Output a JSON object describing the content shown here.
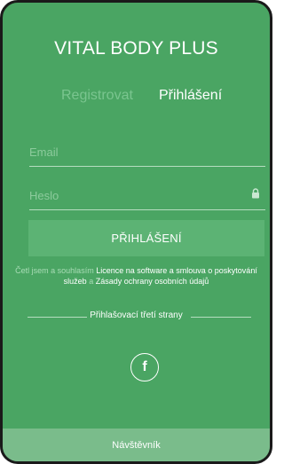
{
  "app": {
    "title": "VITAL BODY PLUS"
  },
  "tabs": [
    {
      "label": "Registrovat",
      "active": false
    },
    {
      "label": "Přihlášení",
      "active": true
    }
  ],
  "form": {
    "email_placeholder": "Email",
    "email_value": "",
    "password_placeholder": "Heslo",
    "password_value": "",
    "password_icon": "lock-icon",
    "submit_label": "PŘIHLÁŠENÍ"
  },
  "terms": {
    "prefix": "Četl jsem a souhlasím",
    "licence_link": "Licence na software a smlouva o poskytování služeb",
    "conjunction": "a",
    "privacy_link": "Zásady ochrany osobních údajů"
  },
  "third_party": {
    "label": "Přihlašovací třetí strany",
    "facebook_icon": "facebook-icon",
    "facebook_glyph": "f"
  },
  "guest": {
    "label": "Návštěvník"
  },
  "colors": {
    "background": "#4aa563",
    "button": "#5cb374",
    "guest_bar": "#7abc8b",
    "inactive_tab": "#7ac58f",
    "text": "#ffffff"
  }
}
